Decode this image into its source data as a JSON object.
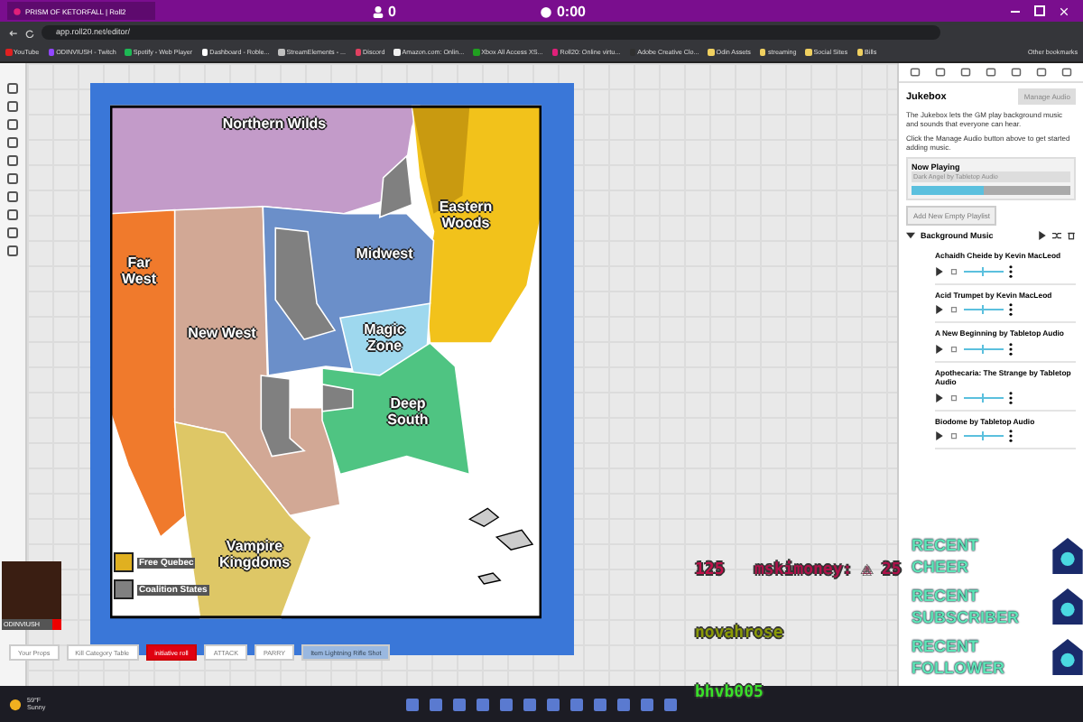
{
  "stream_top": {
    "viewers": "0",
    "timer": "0:00"
  },
  "browser": {
    "tab_title": "PRISM OF KETORFALL | Roll2",
    "url": "app.roll20.net/editor/",
    "bookmarks": [
      {
        "label": "YouTube",
        "color": "#e02020"
      },
      {
        "label": "ODINVIUSH - Twitch",
        "color": "#9146ff"
      },
      {
        "label": "Spotify - Web Player",
        "color": "#1db954"
      },
      {
        "label": "Dashboard - Roble...",
        "color": "#ffffff"
      },
      {
        "label": "StreamElements - ...",
        "color": "#c0c0c0"
      },
      {
        "label": "Discord",
        "color": "#e04060"
      },
      {
        "label": "Amazon.com: Onlin...",
        "color": "#f0f0f0"
      },
      {
        "label": "Xbox All Access XS...",
        "color": "#20a020"
      },
      {
        "label": "Roll20: Online virtu...",
        "color": "#e0207a"
      },
      {
        "label": "Adobe Creative Clo...",
        "color": "#303030"
      },
      {
        "label": "Odin Assets",
        "color": "#f0d060"
      },
      {
        "label": "streaming",
        "color": "#f0d060"
      },
      {
        "label": "Social Sites",
        "color": "#f0d060"
      },
      {
        "label": "Bills",
        "color": "#f0d060"
      }
    ],
    "other_bookmarks": "Other bookmarks"
  },
  "map": {
    "regions": [
      {
        "label": "Northern Wilds",
        "color": "#c39bc9"
      },
      {
        "label": "Eastern Woods",
        "color": "#f2c21b"
      },
      {
        "label": "Far West",
        "color": "#f07a2c"
      },
      {
        "label": "New West",
        "color": "#d2a895"
      },
      {
        "label": "Midwest",
        "color": "#6b8fc9"
      },
      {
        "label": "Magic Zone",
        "color": "#9ed8ee"
      },
      {
        "label": "Deep South",
        "color": "#4fc482"
      },
      {
        "label": "Vampire Kingdoms",
        "color": "#dec766"
      }
    ],
    "legend": [
      {
        "label": "Free Quebec",
        "color": "#e0b020"
      },
      {
        "label": "Coalition States",
        "color": "#808080"
      }
    ]
  },
  "player": {
    "name": "ODINVIUSH"
  },
  "macros": [
    {
      "label": "Your Props",
      "kind": "plain"
    },
    {
      "label": "Kill Category Table",
      "kind": "plain"
    },
    {
      "label": "initiative roll",
      "kind": "alert"
    },
    {
      "label": "ATTACK",
      "kind": "plain"
    },
    {
      "label": "PARRY",
      "kind": "plain"
    },
    {
      "label": "Item Lightning Rifle Shot",
      "kind": "soft"
    }
  ],
  "jukebox": {
    "title": "Jukebox",
    "manage_button": "Manage Audio",
    "description": [
      "The Jukebox lets the GM play background music and sounds that everyone can hear.",
      "Click the Manage Audio button above to get started adding music."
    ],
    "now_playing": {
      "heading": "Now Playing",
      "track": "Dark Angel by Tabletop Audio",
      "level": 0.45
    },
    "add_playlist": "Add New Empty Playlist",
    "playlist": {
      "name": "Background Music",
      "expanded": true,
      "tracks": [
        {
          "title": "Achaidh Cheide by Kevin MacLeod",
          "level": 0.45
        },
        {
          "title": "Acid Trumpet by Kevin MacLeod",
          "level": 0.45
        },
        {
          "title": "A New Beginning by Tabletop Audio",
          "level": 0.45
        },
        {
          "title": "Apothecaria: The Strange by Tabletop Audio",
          "level": 0.45
        },
        {
          "title": "Biodome by Tabletop Audio",
          "level": 0.45
        }
      ]
    }
  },
  "overlay": {
    "alerts": [
      "RECENT CHEER",
      "RECENT SUBSCRIBER",
      "RECENT FOLLOWER"
    ],
    "chat": [
      {
        "text": "125",
        "color": "#c0104a"
      },
      {
        "text": "mskimoney: ⚠ 25",
        "color": "#b0104a"
      },
      {
        "text": "novahrose",
        "color": "#8a9a08"
      },
      {
        "text": "bhvb005",
        "color": "#3ae02a"
      }
    ]
  },
  "taskbar": {
    "temp": "59°F",
    "weather": "Sunny"
  }
}
